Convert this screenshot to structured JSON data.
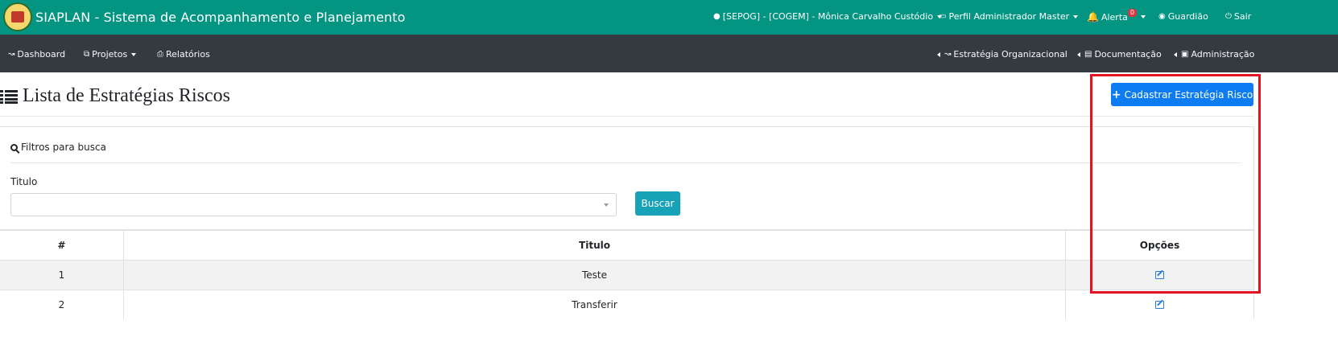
{
  "topbar": {
    "title": "SIAPLAN - Sistema de Acompanhamento e Planejamento",
    "user": "[SEPOG] - [COGEM] - Mônica Carvalho Custódio",
    "profile": "Perfil Administrador Master",
    "alert_label": "Alerta",
    "alert_count": "0",
    "guardian": "Guardião",
    "logout": "Sair",
    "bg_color": "#039482"
  },
  "nav": {
    "dashboard": "Dashboard",
    "projects": "Projetos",
    "reports": "Relatórios",
    "org_strategy": "Estratégia Organizacional",
    "documentation": "Documentação",
    "administration": "Administração"
  },
  "page": {
    "title": "Lista de Estratégias Riscos",
    "create_button": "Cadastrar Estratégia Risco"
  },
  "filters": {
    "heading": "Filtros para busca",
    "title_label": "Titulo",
    "title_value": "",
    "search_button": "Buscar"
  },
  "table": {
    "headers": [
      "#",
      "Titulo",
      "Opções"
    ],
    "rows": [
      {
        "num": "1",
        "title": "Teste",
        "action_icon": "edit-icon"
      },
      {
        "num": "2",
        "title": "Transferir",
        "action_icon": "edit-icon"
      }
    ]
  }
}
